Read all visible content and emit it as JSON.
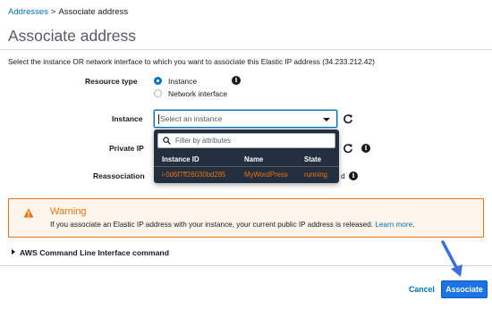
{
  "breadcrumb": {
    "parent": "Addresses",
    "separator": ">",
    "current": "Associate address"
  },
  "page_title": "Associate address",
  "intro": "Select the instance OR network interface to which you want to associate this Elastic IP address (34.233.212.42)",
  "resource_type": {
    "label": "Resource type",
    "options": [
      "Instance",
      "Network interface"
    ],
    "selected": "Instance"
  },
  "instance": {
    "label": "Instance",
    "placeholder": "Select an instance",
    "filter_placeholder": "Filter by attributes",
    "columns": [
      "Instance ID",
      "Name",
      "State"
    ],
    "rows": [
      {
        "id": "i-0d6f7ff26030bd285",
        "name": "MyWordPress",
        "state": "running"
      }
    ]
  },
  "private_ip": {
    "label": "Private IP"
  },
  "reassociation": {
    "label": "Reassociation",
    "visible_fragment": "d"
  },
  "warning": {
    "title": "Warning",
    "text": "If you associate an Elastic IP address with your instance, your current public IP address is released.",
    "link": "Learn more",
    "trailing": "."
  },
  "cli_section": "AWS Command Line Interface command",
  "actions": {
    "cancel": "Cancel",
    "associate": "Associate"
  },
  "colors": {
    "link": "#0073bb",
    "warning": "#ec7211",
    "primary_button": "#1a73e8",
    "dropdown_bg": "#232f3e",
    "pointer": "#3b6fe0"
  },
  "icons": [
    "info-icon",
    "refresh-icon",
    "search-icon",
    "warning-icon",
    "expand-triangle-icon",
    "pointer-arrow-icon"
  ]
}
